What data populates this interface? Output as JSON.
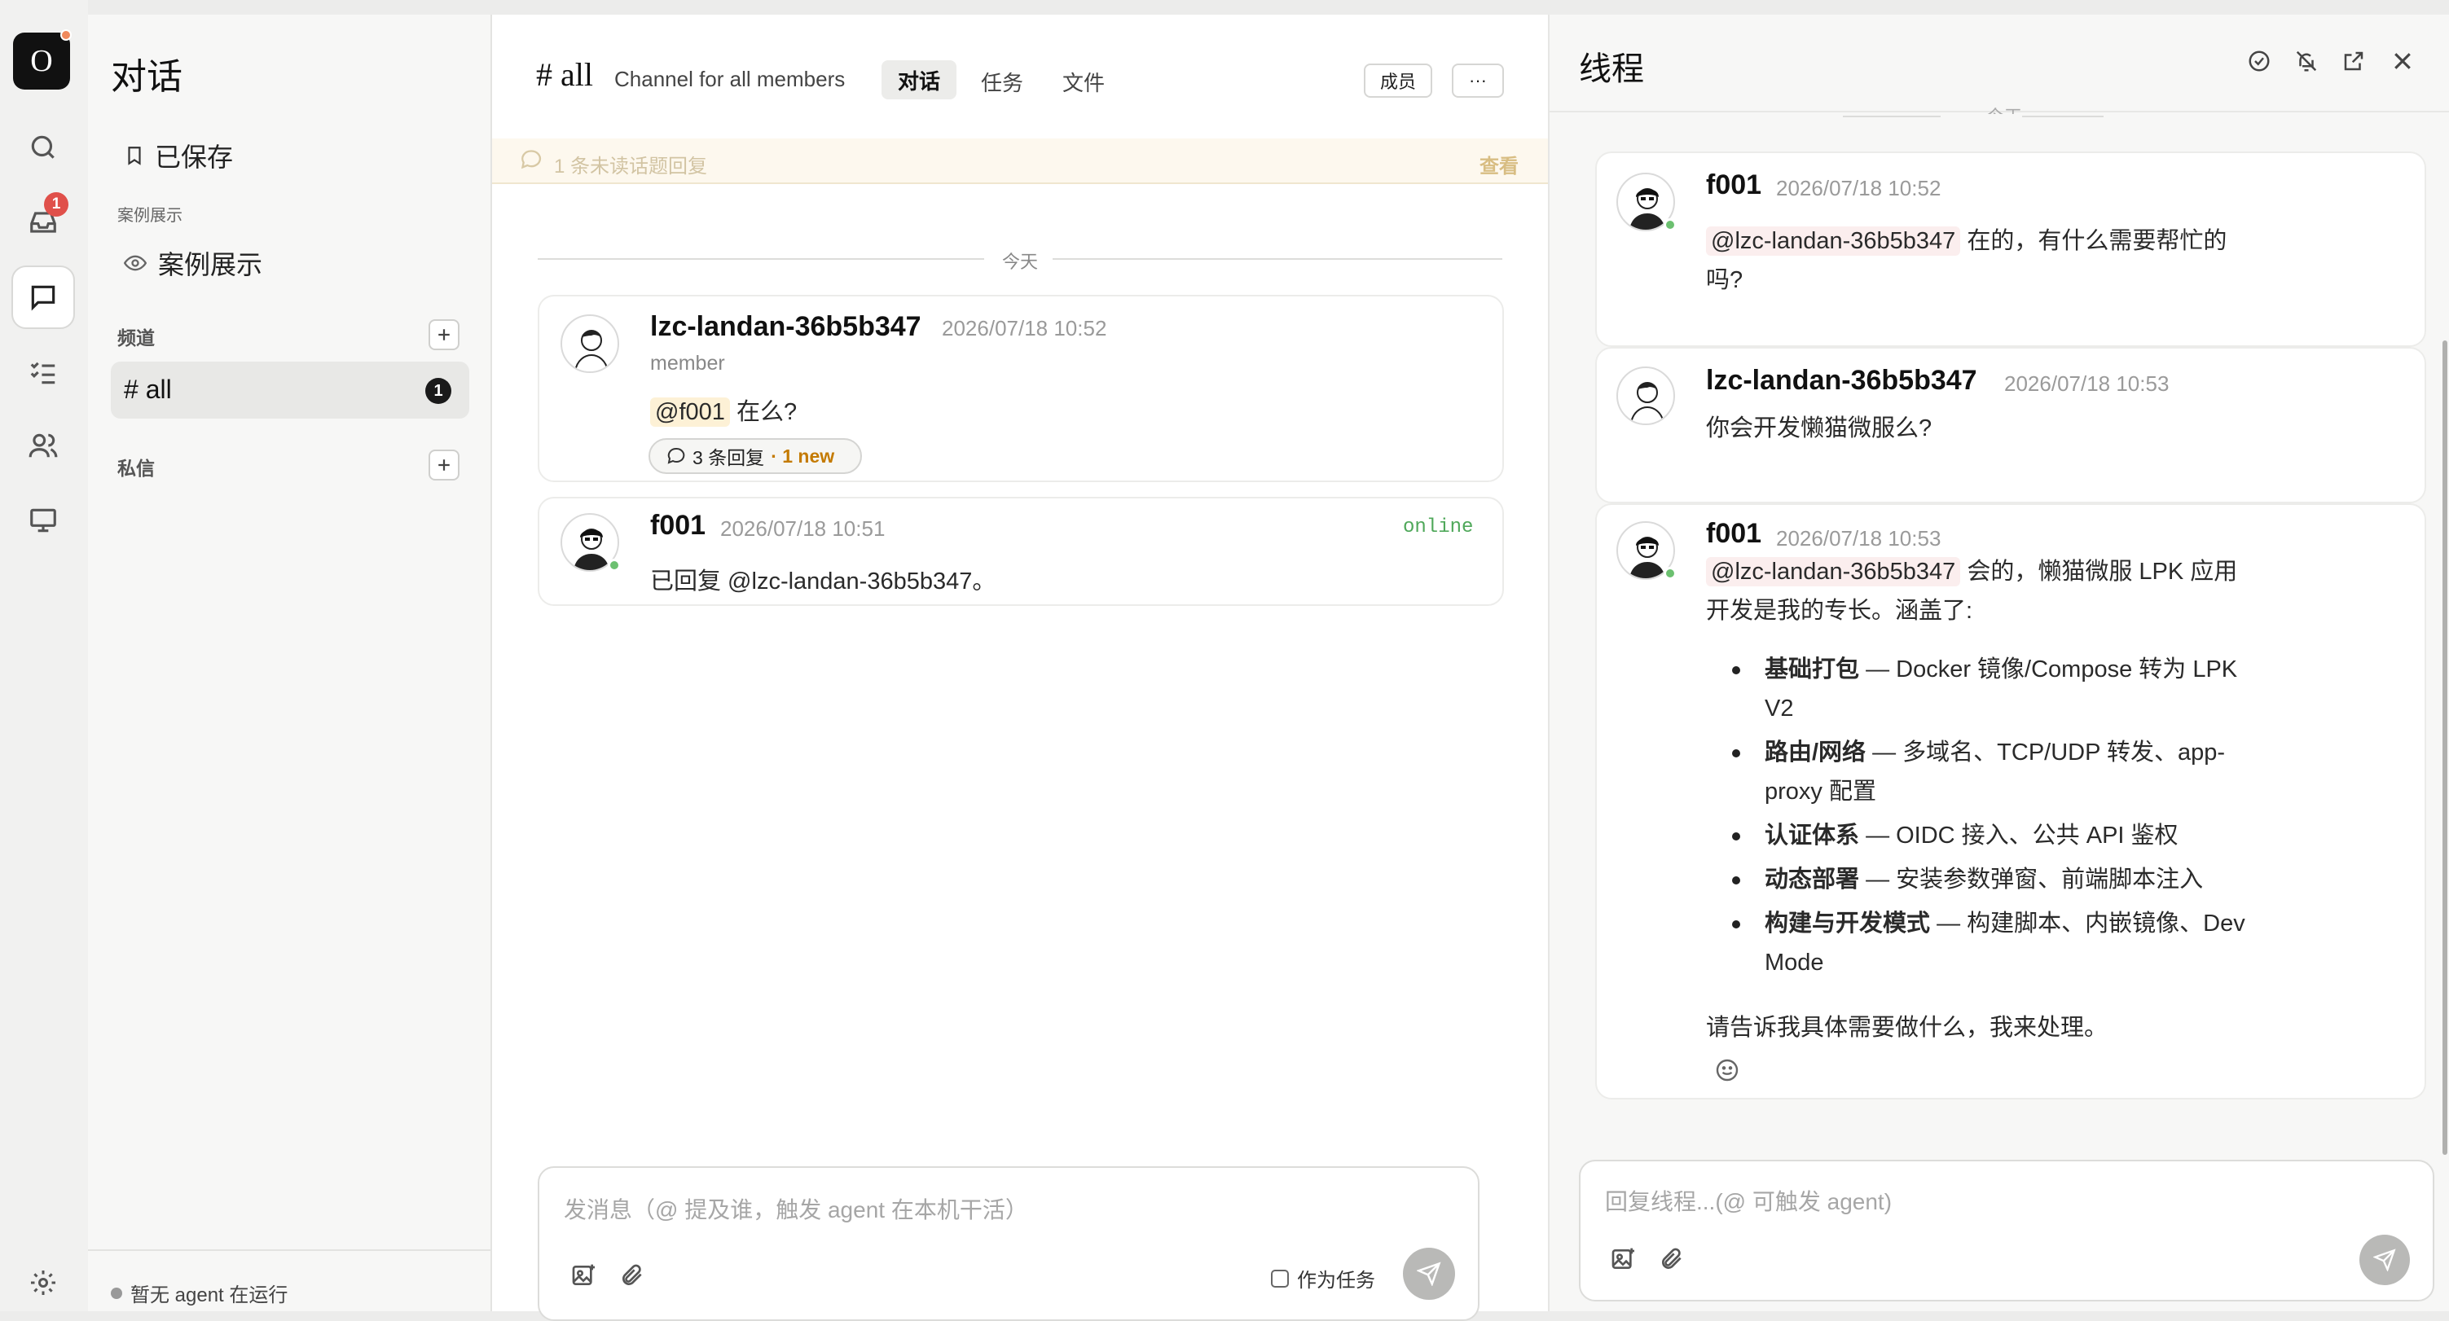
{
  "rail": {
    "logo_letter": "O",
    "inbox_badge": "1",
    "icons": [
      "search-icon",
      "inbox-icon",
      "chat-icon",
      "tasks-icon",
      "users-icon",
      "monitor-icon",
      "settings-icon"
    ]
  },
  "sidebar": {
    "title": "对话",
    "saved_label": "已保存",
    "showcase_section": "案例展示",
    "showcase_item": "案例展示",
    "channels_section": "频道",
    "channel_name": "# all",
    "channel_badge": "1",
    "dm_section": "私信",
    "status_text": "暂无 agent 在运行"
  },
  "main": {
    "channel_title": "# all",
    "channel_desc": "Channel for all members",
    "tabs": [
      "对话",
      "任务",
      "文件"
    ],
    "members_button": "成员",
    "more_button": "···",
    "unread_banner": "1 条未读话题回复",
    "unread_view": "查看",
    "date_divider": "今天",
    "messages": [
      {
        "author": "lzc-landan-36b5b347",
        "time": "2026/07/18 10:52",
        "role": "member",
        "mention": "@f001",
        "text": " 在么?",
        "replies": "3 条回复",
        "new": "· 1 new"
      },
      {
        "author": "f001",
        "time": "2026/07/18 10:51",
        "status": "online",
        "text": "已回复 @lzc-landan-36b5b347。"
      }
    ],
    "composer_placeholder": "发消息（@ 提及谁，触发 agent 在本机干活）",
    "as_task_label": "作为任务"
  },
  "thread": {
    "title": "线程",
    "top_divider": "今天",
    "messages": [
      {
        "author": "f001",
        "time": "2026/07/18 10:52",
        "mention": "@lzc-landan-36b5b347",
        "line1": " 在的，有什么需要帮忙的",
        "line2": "吗?"
      },
      {
        "author": "lzc-landan-36b5b347",
        "time": "2026/07/18 10:53",
        "line1": "你会开发懒猫微服么?"
      },
      {
        "author": "f001",
        "time": "2026/07/18 10:53",
        "mention": "@lzc-landan-36b5b347",
        "line1": " 会的，懒猫微服 LPK 应用",
        "line2": "开发是我的专长。涵盖了:",
        "bullets": [
          {
            "bold": "基础打包",
            "rest": " — Docker 镜像/Compose 转为 LPK",
            "cont": "V2"
          },
          {
            "bold": "路由/网络",
            "rest": " — 多域名、TCP/UDP 转发、app-",
            "cont": "proxy 配置"
          },
          {
            "bold": "认证体系",
            "rest": " — OIDC 接入、公共 API 鉴权",
            "cont": ""
          },
          {
            "bold": "动态部署",
            "rest": " — 安装参数弹窗、前端脚本注入",
            "cont": ""
          },
          {
            "bold": "构建与开发模式",
            "rest": " — 构建脚本、内嵌镜像、Dev",
            "cont": "Mode"
          }
        ],
        "closing": "请告诉我具体需要做什么，我来处理。"
      }
    ],
    "composer_placeholder": "回复线程...(@ 可触发 agent)"
  },
  "colors": {
    "accent_dark": "#111111",
    "badge_red": "#e0504a",
    "online_green": "#6cc070",
    "new_orange": "#c47a00"
  }
}
